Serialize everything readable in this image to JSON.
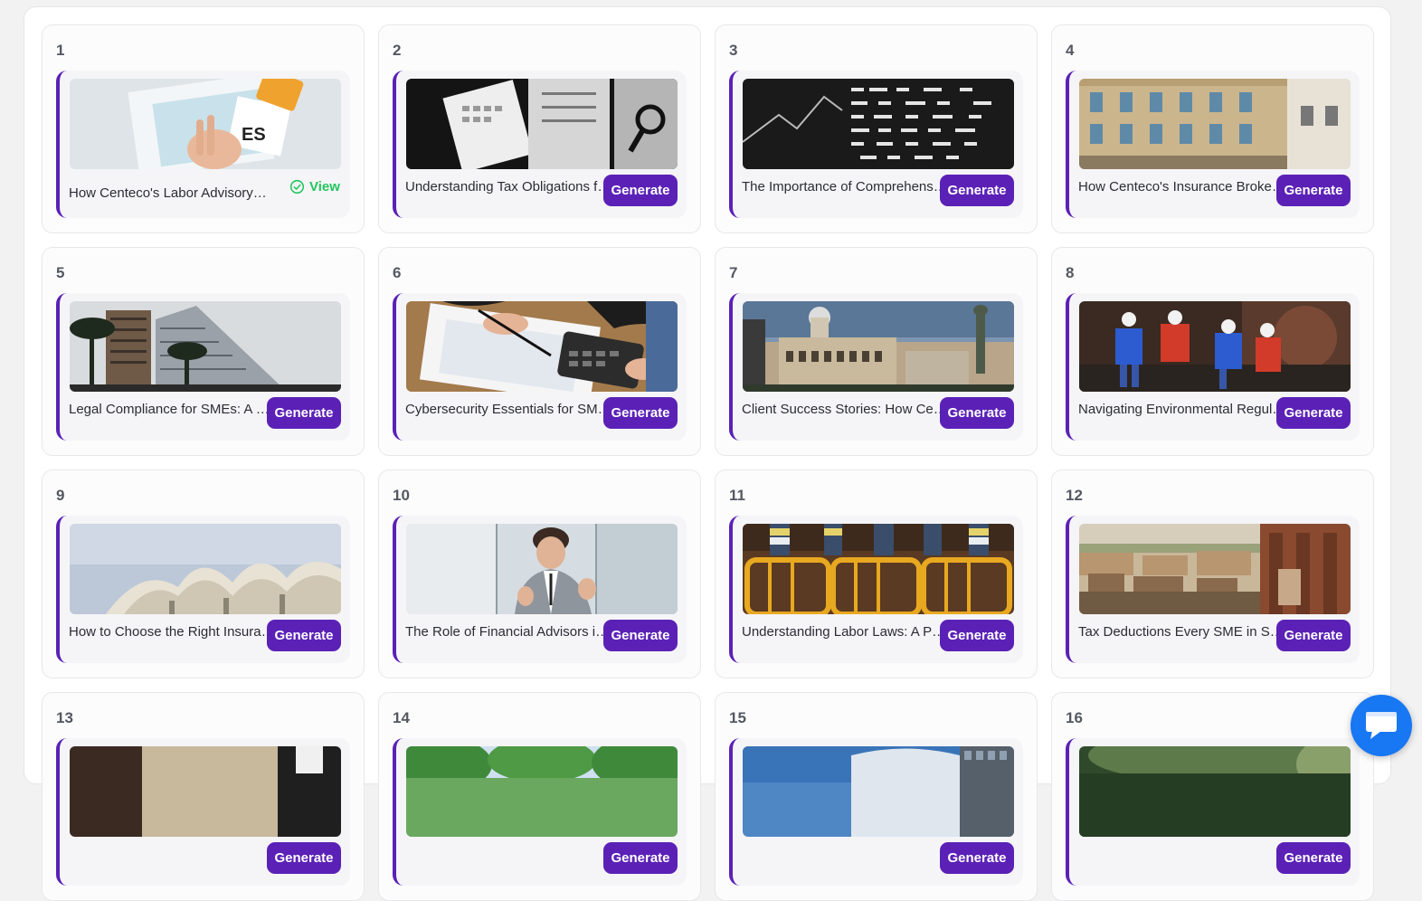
{
  "cards": [
    {
      "number": "1",
      "title": "How Centeco's Labor Advisory Services Help",
      "action": "View"
    },
    {
      "number": "2",
      "title": "Understanding Tax Obligations for Businesses",
      "action": "Generate"
    },
    {
      "number": "3",
      "title": "The Importance of Comprehensive Insurance",
      "action": "Generate"
    },
    {
      "number": "4",
      "title": "How Centeco's Insurance Brokerage Works",
      "action": "Generate"
    },
    {
      "number": "5",
      "title": "Legal Compliance for SMEs: A Guide",
      "action": "Generate"
    },
    {
      "number": "6",
      "title": "Cybersecurity Essentials for SMEs",
      "action": "Generate"
    },
    {
      "number": "7",
      "title": "Client Success Stories: How Centeco Helped",
      "action": "Generate"
    },
    {
      "number": "8",
      "title": "Navigating Environmental Regulations",
      "action": "Generate"
    },
    {
      "number": "9",
      "title": "How to Choose the Right Insurance Policy",
      "action": "Generate"
    },
    {
      "number": "10",
      "title": "The Role of Financial Advisors in Growth",
      "action": "Generate"
    },
    {
      "number": "11",
      "title": "Understanding Labor Laws: A Primer",
      "action": "Generate"
    },
    {
      "number": "12",
      "title": "Tax Deductions Every SME in Spain Should Know",
      "action": "Generate"
    },
    {
      "number": "13",
      "title": "",
      "action": "Generate"
    },
    {
      "number": "14",
      "title": "",
      "action": "Generate"
    },
    {
      "number": "15",
      "title": "",
      "action": "Generate"
    },
    {
      "number": "16",
      "title": "",
      "action": "Generate"
    }
  ],
  "icons": {
    "view": "check-circle-icon",
    "chat": "chat-bubble-icon"
  },
  "colors": {
    "accent": "#5b21b6",
    "view_green": "#22c55e",
    "chat_blue": "#1877f2"
  }
}
